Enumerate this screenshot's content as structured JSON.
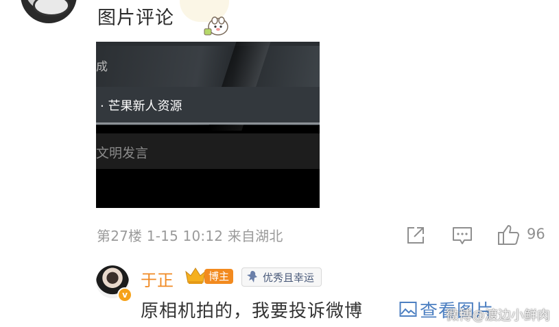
{
  "header": {
    "title": "图片评论"
  },
  "image_comment": {
    "text_cheng": "成",
    "link_text": "· 芒果新人资源",
    "input_placeholder": "文明发言"
  },
  "meta": {
    "floor_time_loc": "第27楼  1-15 10:12  来自湖北",
    "like_count": "96"
  },
  "reply": {
    "name": "于正",
    "badge_bozhu": "博主",
    "badge_lucky": "优秀且幸运",
    "text": "原相机拍的，我要投诉微博",
    "view_pic": "查看图片",
    "verified_mark": "v"
  },
  "watermark": "微博@渡边小鲜肉",
  "colors": {
    "name": "#f08a24",
    "link": "#4c7fc1",
    "meta": "#9a9a9a"
  },
  "icons": [
    "share-icon",
    "comment-icon",
    "like-icon",
    "crown-icon",
    "lucky-badge-icon",
    "picture-icon"
  ]
}
